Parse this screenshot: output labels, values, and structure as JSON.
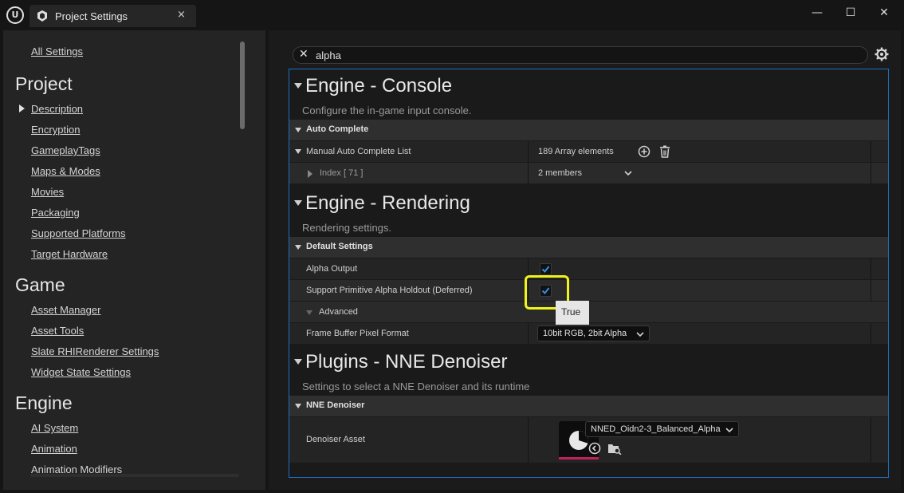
{
  "window": {
    "tab_title": "Project Settings",
    "tab_close": "×",
    "minimize": "—",
    "maximize": "☐",
    "close": "✕"
  },
  "sidebar": {
    "all_settings": "All Settings",
    "categories": [
      {
        "title": "Project",
        "items": [
          "Description",
          "Encryption",
          "GameplayTags",
          "Maps & Modes",
          "Movies",
          "Packaging",
          "Supported Platforms",
          "Target Hardware"
        ]
      },
      {
        "title": "Game",
        "items": [
          "Asset Manager",
          "Asset Tools",
          "Slate RHIRenderer Settings",
          "Widget State Settings"
        ]
      },
      {
        "title": "Engine",
        "items": [
          "AI System",
          "Animation",
          "Animation Modifiers"
        ]
      }
    ]
  },
  "search": {
    "value": "alpha"
  },
  "sections": {
    "console": {
      "title": "Engine - Console",
      "description": "Configure the in-game input console.",
      "category": "Auto Complete",
      "list_label": "Manual Auto Complete List",
      "list_value": "189 Array elements",
      "index_label": "Index [ 71 ]",
      "index_value": "2 members"
    },
    "rendering": {
      "title": "Engine - Rendering",
      "description": "Rendering settings.",
      "category": "Default Settings",
      "alpha_output": "Alpha Output",
      "alpha_output_checked": true,
      "holdout": "Support Primitive Alpha Holdout (Deferred)",
      "holdout_checked": true,
      "advanced": "Advanced",
      "frame_buffer": "Frame Buffer Pixel Format",
      "frame_buffer_value": "10bit RGB, 2bit Alpha"
    },
    "denoiser": {
      "title": "Plugins - NNE Denoiser",
      "description": "Settings to select a NNE Denoiser and its runtime",
      "category": "NNE Denoiser",
      "asset_label": "Denoiser Asset",
      "asset_value": "NNED_Oidn2-3_Balanced_Alpha"
    }
  },
  "tooltip": "True",
  "colors": {
    "highlight": "#f2f21b",
    "focus_border": "#1f6fc0",
    "asset_bar": "#c21e5a"
  }
}
